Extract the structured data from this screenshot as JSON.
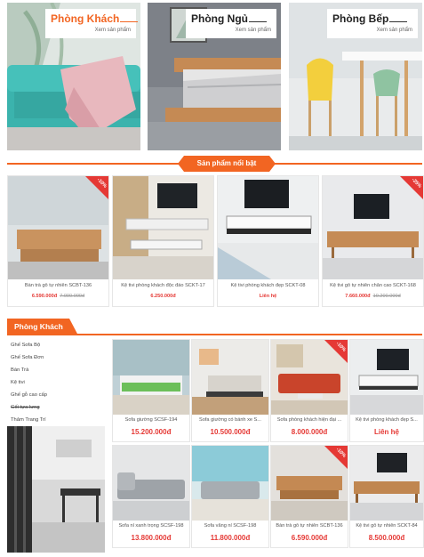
{
  "categories": [
    {
      "name": "Phòng Khách",
      "link_label": "Xem sản phẩm"
    },
    {
      "name": "Phòng Ngủ",
      "link_label": "Xem sản phẩm"
    },
    {
      "name": "Phòng Bếp",
      "link_label": "Xem sản phẩm"
    }
  ],
  "featured": {
    "heading": "Sản phẩm nổi bật",
    "products": [
      {
        "name": "Bàn trà gỗ tự nhiên SCBT-136",
        "price": "6.590.000đ",
        "old_price": "7.000.000đ",
        "badge": "-10%"
      },
      {
        "name": "Kệ tivi phòng khách độc đáo SCKT-17",
        "price": "6.250.000đ",
        "old_price": "",
        "badge": ""
      },
      {
        "name": "Kệ tivi phòng khách đẹp SCKT-08",
        "price": "Liên hệ",
        "old_price": "",
        "badge": ""
      },
      {
        "name": "Kệ tivi gỗ tự nhiên chân cao SCKT-168",
        "price": "7.660.000đ",
        "old_price": "10.200.000đ",
        "badge": "-25%"
      }
    ]
  },
  "living_room": {
    "heading": "Phòng Khách",
    "sidebar": [
      {
        "label": "Ghế Sofa Bộ",
        "struck": false
      },
      {
        "label": "Ghế Sofa Đơn",
        "struck": false
      },
      {
        "label": "Bàn Trà",
        "struck": false
      },
      {
        "label": "Kệ tivi",
        "struck": false
      },
      {
        "label": "Ghế gỗ cao cấp",
        "struck": false
      },
      {
        "label": "Gối tựa lưng",
        "struck": true
      },
      {
        "label": "Thảm Trang Trí",
        "struck": false
      }
    ],
    "products": [
      {
        "name": "Sofa giường SCSF-194",
        "price": "15.200.000đ",
        "badge": ""
      },
      {
        "name": "Sofa giường có bánh xe S...",
        "price": "10.500.000đ",
        "badge": ""
      },
      {
        "name": "Sofa phòng khách hiện đại ...",
        "price": "8.000.000đ",
        "badge": "-10%"
      },
      {
        "name": "Kệ tivi phòng khách đẹp S...",
        "price": "Liên hệ",
        "badge": ""
      },
      {
        "name": "Sofa nỉ xanh trọng SCSF-198",
        "price": "13.800.000đ",
        "badge": ""
      },
      {
        "name": "Sofa văng nỉ SCSF-198",
        "price": "11.800.000đ",
        "badge": ""
      },
      {
        "name": "Bàn trà gỗ tự nhiên SCBT-136",
        "price": "6.590.000đ",
        "badge": "-10%"
      },
      {
        "name": "Kệ tivi gỗ tự nhiên SCKT-84",
        "price": "8.500.000đ",
        "badge": ""
      }
    ]
  },
  "colors": {
    "accent": "#f26522",
    "price": "#e53935"
  }
}
